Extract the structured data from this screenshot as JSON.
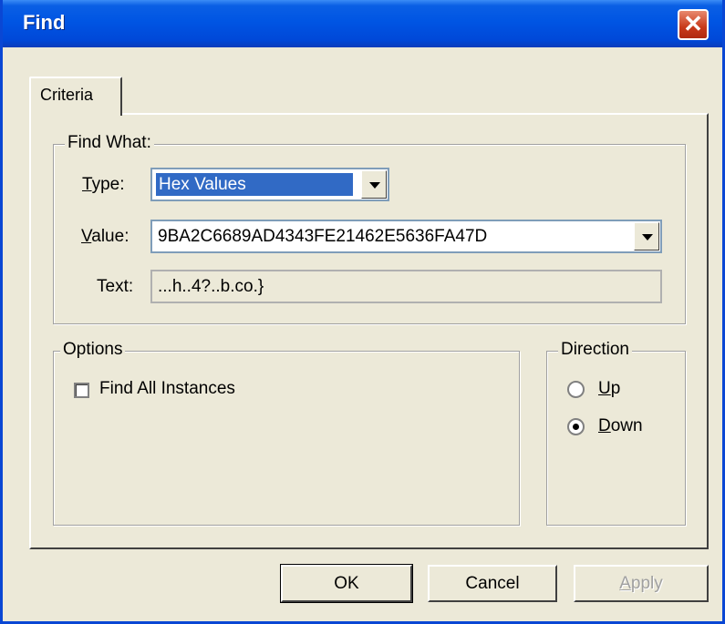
{
  "window": {
    "title": "Find"
  },
  "tabs": [
    {
      "label": "Criteria"
    }
  ],
  "find_what": {
    "legend": "Find What:",
    "type_label_prefix": "T",
    "type_label_rest": "ype:",
    "type_value": "Hex Values",
    "value_label_prefix": "V",
    "value_label_rest": "alue:",
    "value_value": "9BA2C6689AD4343FE21462E5636FA47D",
    "text_label": "Text:",
    "text_value": "...h..4?..b.co.}"
  },
  "options": {
    "legend": "Options",
    "find_all_label": "Find All Instances",
    "find_all_checked": false
  },
  "direction": {
    "legend": "Direction",
    "up_prefix": "U",
    "up_rest": "p",
    "down_prefix": "D",
    "down_rest": "own",
    "selected": "down"
  },
  "buttons": {
    "ok": "OK",
    "cancel": "Cancel",
    "apply_prefix": "A",
    "apply_rest": "pply"
  },
  "colors": {
    "titlebar": "#0055e3",
    "selection": "#316ac5",
    "face": "#ece9d8"
  }
}
